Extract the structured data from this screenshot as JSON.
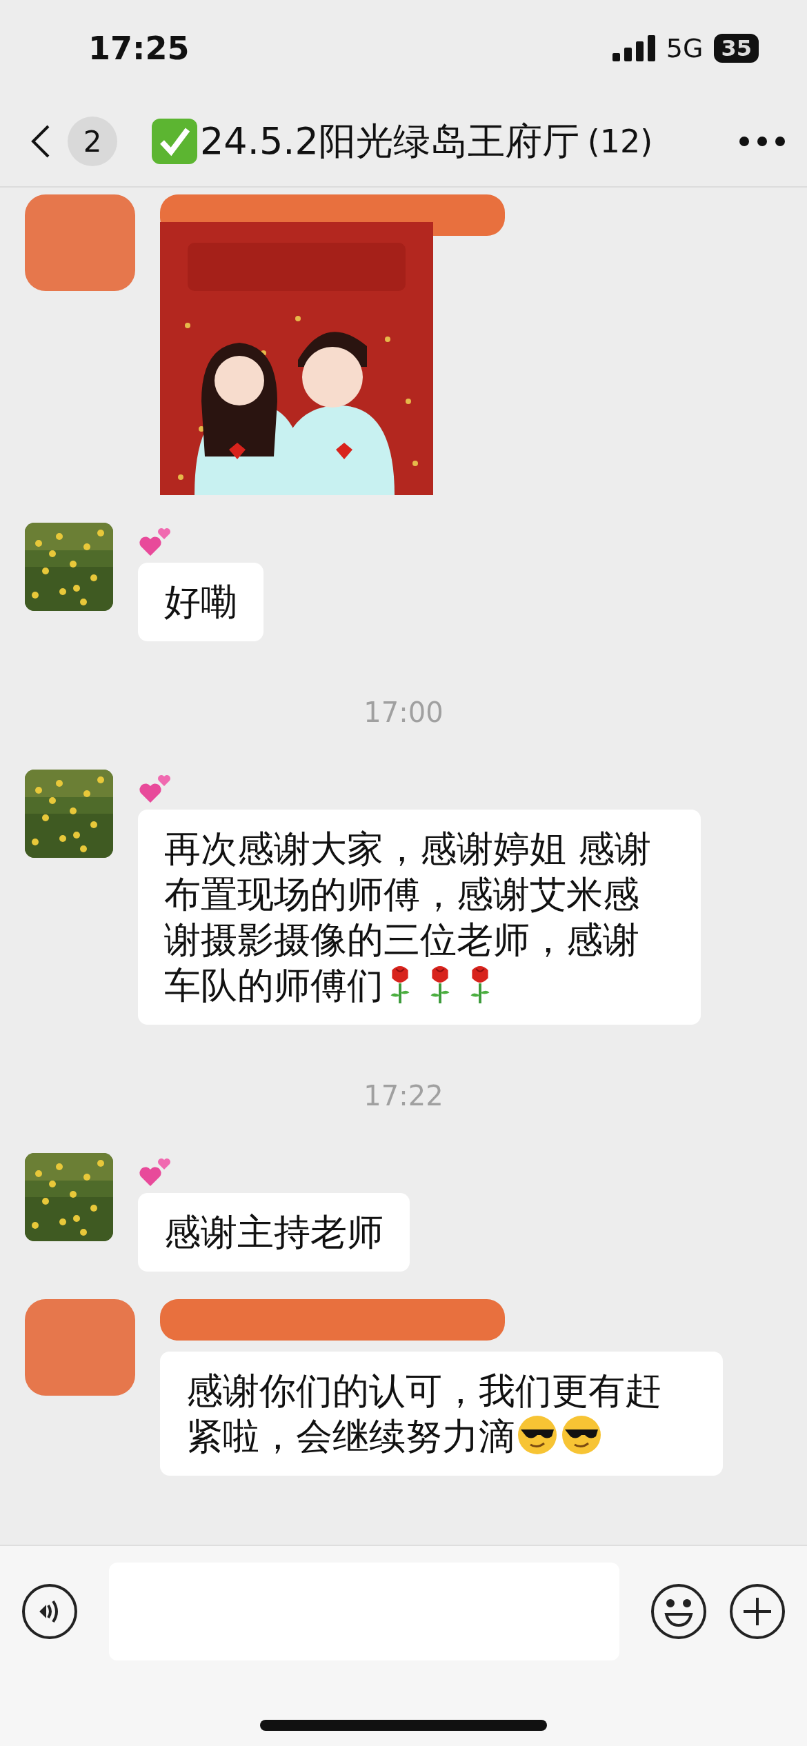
{
  "status_bar": {
    "time": "17:25",
    "network": "5G",
    "battery": "35"
  },
  "header": {
    "back_count": "2",
    "title": "24.5.2阳光绿岛王府厅",
    "member_count": "(12)"
  },
  "messages": [
    {
      "kind": "sticker",
      "redacted": true
    },
    {
      "kind": "text",
      "redacted": false,
      "text": "好嘞"
    },
    {
      "kind": "time",
      "text": "17:00"
    },
    {
      "kind": "text",
      "redacted": false,
      "text": "再次感谢大家，感谢婷姐 感谢布置现场的师傅，感谢艾米感谢摄影摄像的三位老师，感谢车队的师傅们",
      "emoji": [
        {
          "kind": "rose"
        },
        {
          "kind": "rose"
        },
        {
          "kind": "rose"
        }
      ]
    },
    {
      "kind": "time",
      "text": "17:22"
    },
    {
      "kind": "text",
      "redacted": false,
      "text": "感谢主持老师"
    },
    {
      "kind": "text",
      "redacted": true,
      "text": "感谢你们的认可，我们更有赶紧啦，会继续努力滴",
      "emoji": [
        {
          "kind": "sunglasses"
        },
        {
          "kind": "sunglasses"
        }
      ]
    }
  ]
}
